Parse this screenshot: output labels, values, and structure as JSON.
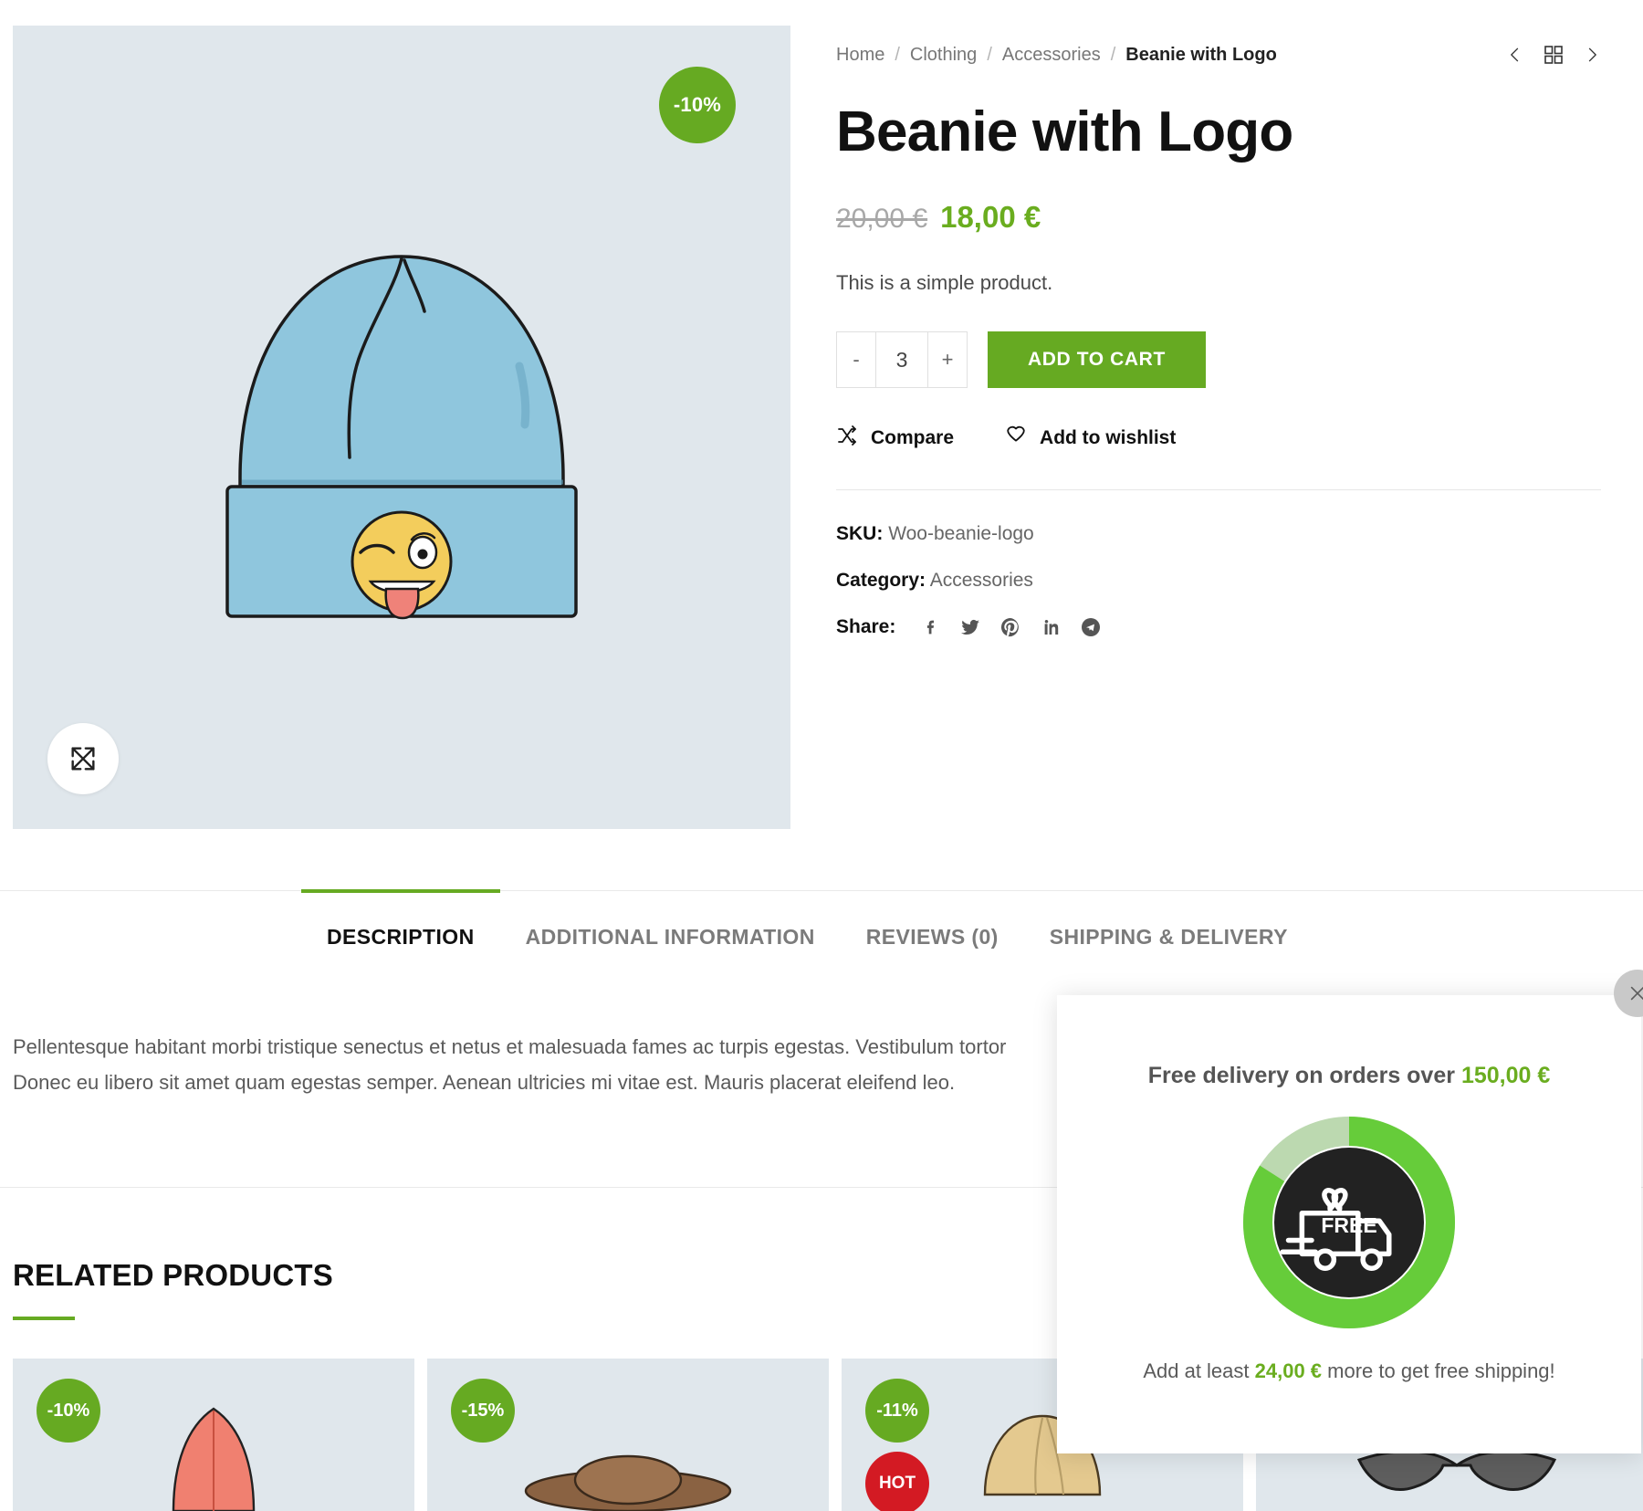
{
  "breadcrumb": {
    "items": [
      "Home",
      "Clothing",
      "Accessories"
    ],
    "current": "Beanie with Logo",
    "separator": "/"
  },
  "nav": {
    "prev_icon": "chevron-left-icon",
    "grid_icon": "grid-icon",
    "next_icon": "chevron-right-icon"
  },
  "product": {
    "title": "Beanie with Logo",
    "price_old": "20,00 €",
    "price_new": "18,00 €",
    "short_description": "This is a simple product.",
    "discount_badge": "-10%",
    "quantity": "3",
    "qty_minus": "-",
    "qty_plus": "+",
    "add_to_cart": "ADD TO CART",
    "compare": "Compare",
    "wishlist": "Add to wishlist",
    "sku_label": "SKU:",
    "sku_value": "Woo-beanie-logo",
    "category_label": "Category:",
    "category_value": "Accessories",
    "share_label": "Share:",
    "share_icons": [
      "facebook-icon",
      "twitter-icon",
      "pinterest-icon",
      "linkedin-icon",
      "telegram-icon"
    ],
    "expand_icon": "expand-arrows-icon"
  },
  "tabs": [
    {
      "label": "DESCRIPTION",
      "active": true
    },
    {
      "label": "ADDITIONAL INFORMATION",
      "active": false
    },
    {
      "label": "REVIEWS (0)",
      "active": false
    },
    {
      "label": "SHIPPING & DELIVERY",
      "active": false
    }
  ],
  "description": {
    "line1": "Pellentesque habitant morbi tristique senectus et netus et malesuada fames ac turpis egestas. Vestibulum tortor",
    "line2": "Donec eu libero sit amet quam egestas semper. Aenean ultricies mi vitae est. Mauris placerat eleifend leo."
  },
  "related": {
    "heading": "RELATED PRODUCTS",
    "products": [
      {
        "badge": "-10%",
        "hot": "",
        "color": "#f08070"
      },
      {
        "badge": "-15%",
        "hot": "",
        "color": "#8a6242"
      },
      {
        "badge": "-11%",
        "hot": "HOT",
        "color": "#e4c98f"
      },
      {
        "badge": "",
        "hot": "",
        "color": "#6b6b6b"
      }
    ]
  },
  "popup": {
    "title_prefix": "Free delivery on orders over",
    "threshold": "150,00 €",
    "foot_prefix": "Add at least",
    "remaining": "24,00 €",
    "foot_suffix": "more to get free shipping!",
    "truck_label": "FREE",
    "progress_percent": 84,
    "close_icon": "close-icon"
  },
  "colors": {
    "accent": "#66aa22",
    "price": "#6aad1f",
    "hot": "#d31a23",
    "gallery_bg": "#e0e7ec"
  }
}
